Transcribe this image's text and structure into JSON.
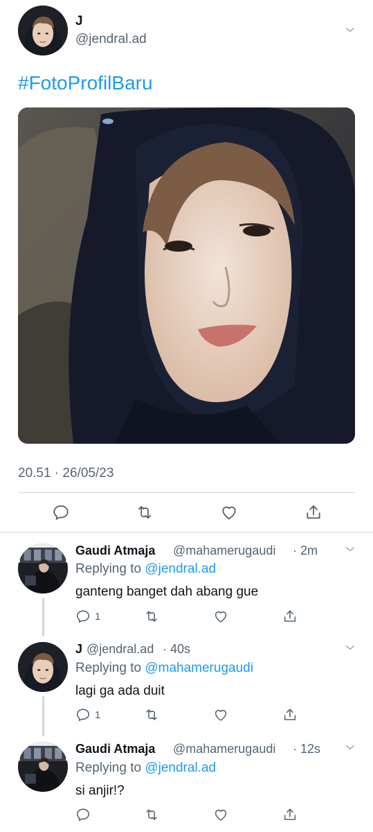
{
  "tweet": {
    "author_name": "J",
    "author_handle": "@jendral.ad",
    "text": "#FotoProfilBaru",
    "timestamp": "20.51 · 26/05/23"
  },
  "replies": [
    {
      "name": "Gaudi Atmaja",
      "handle": "@mahamerugaudi",
      "time": "· 2m",
      "replying_prefix": "Replying to",
      "replying_to": "@jendral.ad",
      "text": "ganteng banget dah abang gue",
      "reply_count": "1"
    },
    {
      "name": "J",
      "handle": "@jendral.ad",
      "time": "· 40s",
      "replying_prefix": "Replying to",
      "replying_to": "@mahamerugaudi",
      "text": "lagi ga ada duit",
      "reply_count": "1"
    },
    {
      "name": "Gaudi Atmaja",
      "handle": "@mahamerugaudi",
      "time": "· 12s",
      "replying_prefix": "Replying to",
      "replying_to": "@jendral.ad",
      "text": "si anjir!?",
      "reply_count": ""
    }
  ],
  "icons": {
    "reply": "reply-icon",
    "retweet": "retweet-icon",
    "like": "heart-icon",
    "share": "share-icon",
    "more": "chevron-down-icon"
  },
  "colors": {
    "accent": "#1d9bf0",
    "secondary_text": "#536471",
    "divider": "#cfd9de"
  }
}
